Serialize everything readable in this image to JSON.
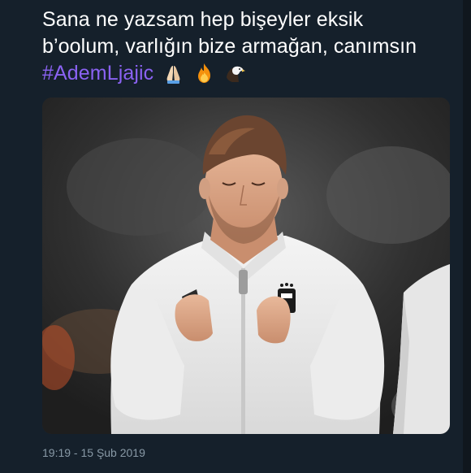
{
  "tweet": {
    "line1": "Sana ne yazsam hep bişeyler eksik",
    "line2": "b’oolum, varlığın bize armağan, canımsın",
    "hashtag": "#AdemLjajic",
    "emojis": [
      "praying-hands-icon",
      "fire-icon",
      "eagle-icon"
    ]
  },
  "media": {
    "description_icon": "photo"
  },
  "meta": {
    "timestamp": "19:19 - 15 Şub 2019"
  },
  "colors": {
    "background": "#15202b",
    "text": "#ffffff",
    "hashtag": "#8a62f2",
    "muted": "#8899a6"
  }
}
